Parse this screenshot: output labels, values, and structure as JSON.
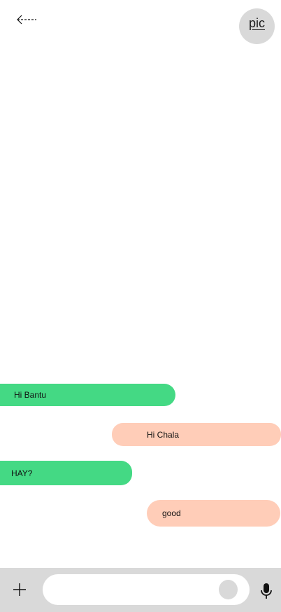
{
  "header": {
    "back_icon": "back-arrow-icon",
    "avatar_label": "pic"
  },
  "colors": {
    "incoming": "#44d984",
    "outgoing": "#ffcdb8",
    "composer_bar": "#d9d9d9",
    "avatar_bg": "#d9d9d9"
  },
  "messages": [
    {
      "sender": "other",
      "text": "Hi Bantu"
    },
    {
      "sender": "me",
      "text": "Hi Chala"
    },
    {
      "sender": "other",
      "text": "HAY?"
    },
    {
      "sender": "me",
      "text": "good"
    }
  ],
  "composer": {
    "attach_icon": "plus-icon",
    "mic_icon": "microphone-icon"
  }
}
